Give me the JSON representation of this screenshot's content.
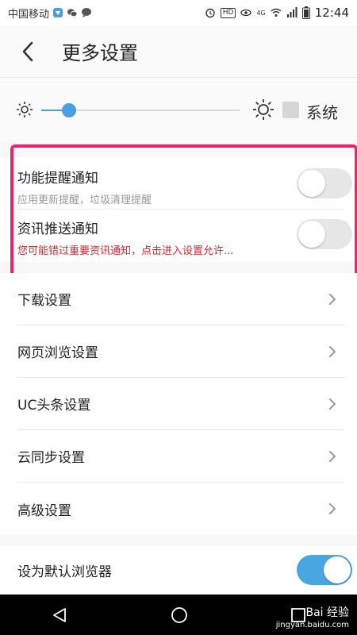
{
  "status_bar": {
    "carrier": "中国移动",
    "network_badge": "4G",
    "hd_badge": "HD",
    "time": "12:44",
    "icons": [
      "notification-app-icon",
      "wechat-icon",
      "message-icon",
      "alarm-icon",
      "eye-icon",
      "wifi-icon",
      "signal-icon",
      "battery-icon"
    ]
  },
  "header": {
    "title": "更多设置",
    "back_icon": "chevron-left-icon"
  },
  "brightness": {
    "level_percent": 14,
    "system_label": "系统",
    "system_checked": false
  },
  "notifications": [
    {
      "title": "功能提醒通知",
      "subtitle": "应用更新提醒，垃圾清理提醒",
      "enabled": false,
      "warning": false
    },
    {
      "title": "资讯推送通知",
      "subtitle": "您可能错过重要资讯通知，点击进入设置允许...",
      "enabled": false,
      "warning": true
    }
  ],
  "settings_menu": [
    {
      "label": "下载设置"
    },
    {
      "label": "网页浏览设置"
    },
    {
      "label": "UC头条设置"
    },
    {
      "label": "云同步设置"
    },
    {
      "label": "高级设置"
    }
  ],
  "default_browser": {
    "label": "设为默认浏览器",
    "enabled": true
  },
  "watermark": {
    "brand": "Bai 经验",
    "domain": "jingyan.baidu.com"
  },
  "colors": {
    "accent": "#4a9fe0",
    "highlight": "#e8256d",
    "warning": "#d9252e"
  }
}
